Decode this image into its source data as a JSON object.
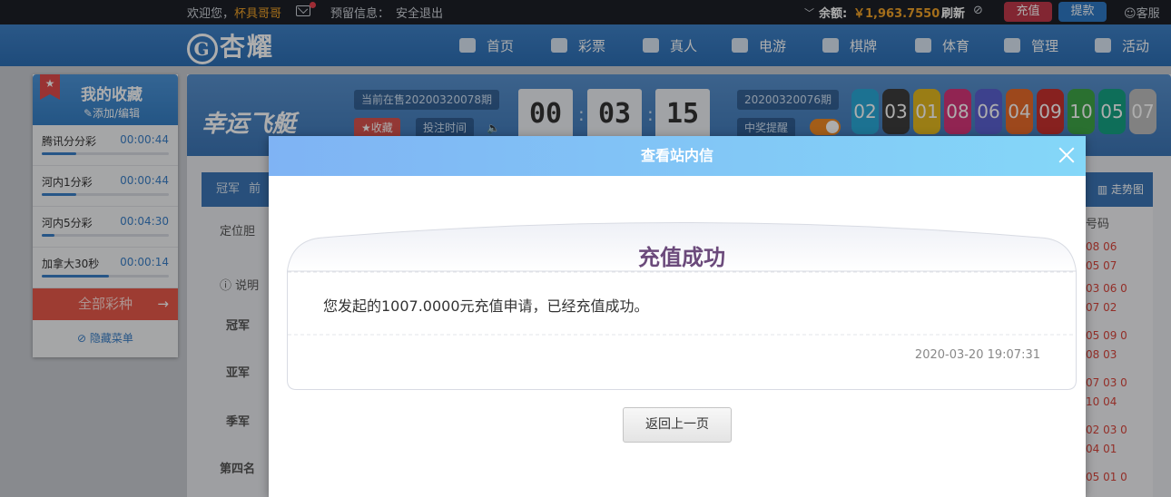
{
  "topbar": {
    "welcome": "欢迎您，",
    "username": "杯具哥哥",
    "reserved_info": "预留信息：",
    "logout": "安全退出",
    "balance_label": "余额:",
    "balance": "￥1,963.7550",
    "refresh": "刷新",
    "deposit": "充值",
    "withdraw": "提款",
    "service": "客服"
  },
  "header": {
    "logo": "杏耀",
    "logo_mark": "G",
    "nav": [
      "首页",
      "彩票",
      "真人",
      "电游",
      "棋牌",
      "体育",
      "管理",
      "活动"
    ]
  },
  "sidebar": {
    "bookmark": "★",
    "title": "我的收藏",
    "add_edit": "✎添加/编辑",
    "items": [
      {
        "name": "腾讯分分彩",
        "time": "00:00:44",
        "progress": 0.27
      },
      {
        "name": "河内1分彩",
        "time": "00:00:44",
        "progress": 0.27
      },
      {
        "name": "河内5分彩",
        "time": "00:04:30",
        "progress": 0.1
      },
      {
        "name": "加拿大30秒",
        "time": "00:00:14",
        "progress": 0.53
      }
    ],
    "all_lottery": "全部彩种",
    "all_lottery_arrow": "→",
    "hide_menu": "隐藏菜单"
  },
  "game": {
    "logo": "幸运飞艇",
    "current_period": "当前在售20200320078期",
    "collect": "★收藏",
    "bet_time": "投注时间",
    "countdown": [
      "00",
      "03",
      "15"
    ],
    "colon": ":",
    "last_period": "20200320076期",
    "win_alert": "中奖提醒",
    "balls": [
      {
        "n": "02",
        "color": "#2aa9d8"
      },
      {
        "n": "03",
        "color": "#3d3d3d"
      },
      {
        "n": "01",
        "color": "#e3b81f"
      },
      {
        "n": "08",
        "color": "#d63579"
      },
      {
        "n": "06",
        "color": "#5a60d0"
      },
      {
        "n": "04",
        "color": "#e86a2a"
      },
      {
        "n": "09",
        "color": "#c8322e"
      },
      {
        "n": "10",
        "color": "#3fa548"
      },
      {
        "n": "05",
        "color": "#15a283"
      },
      {
        "n": "07",
        "color": "#bfbfbf"
      }
    ],
    "tab_first": "冠军",
    "tab_second": "前",
    "positioning": "定位胆",
    "explain": "说明",
    "rows": [
      "冠军",
      "亚军",
      "季军",
      "第四名"
    ],
    "trend": "走势图",
    "number_header": "号码",
    "numbers": [
      "08 06",
      "05 07",
      "03 06 0",
      "07 02",
      "05 09 0",
      "08 03",
      "07 03 0",
      "10 04",
      "02 03 0",
      "04 01",
      "05 01 0"
    ]
  },
  "modal": {
    "title": "查看站内信",
    "letter_title": "充值成功",
    "letter_body": "您发起的1007.0000元充值申请，已经充值成功。",
    "date": "2020-03-20 19:07:31",
    "back": "返回上一页"
  }
}
